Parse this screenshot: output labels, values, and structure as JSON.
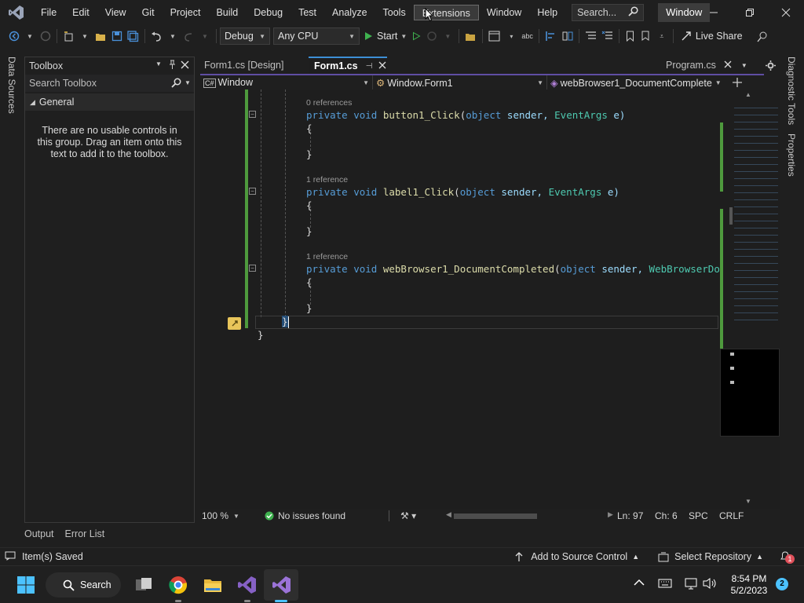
{
  "menubar": {
    "items": [
      "File",
      "Edit",
      "View",
      "Git",
      "Project",
      "Build",
      "Debug",
      "Test",
      "Analyze",
      "Tools",
      "Extensions",
      "Window",
      "Help"
    ],
    "active_index": 10,
    "search_placeholder": "Search...",
    "window_badge": "Window"
  },
  "toolbar": {
    "config": "Debug",
    "platform": "Any CPU",
    "start_label": "Start",
    "live_share": "Live Share"
  },
  "side_tabs": {
    "left": "Data Sources",
    "right_top": "Diagnostic Tools",
    "right_bottom": "Properties"
  },
  "toolbox": {
    "title": "Toolbox",
    "search_placeholder": "Search Toolbox",
    "group": "General",
    "message": "There are no usable controls in this group. Drag an item onto this text to add it to the toolbox."
  },
  "doc_tabs": [
    {
      "label": "Form1.cs [Design]",
      "active": false
    },
    {
      "label": "Form1.cs",
      "active": true
    },
    {
      "label": "Program.cs",
      "active": false
    }
  ],
  "navbar": {
    "project": "Window",
    "type": "Window.Form1",
    "member": "webBrowser1_DocumentComplete"
  },
  "code": {
    "methods": [
      {
        "refs": "0 references",
        "name": "button1_Click",
        "args": "EventArgs e)",
        "argtype": "EventArgs",
        "argname": "e)"
      },
      {
        "refs": "1 reference",
        "name": "label1_Click",
        "args": "EventArgs e)",
        "argtype": "EventArgs",
        "argname": "e)"
      },
      {
        "refs": "1 reference",
        "name": "webBrowser1_DocumentCompleted",
        "argtype": "WebBrowserDo",
        "argname": ""
      }
    ],
    "keyword_private": "private",
    "keyword_void": "void",
    "keyword_object": "object",
    "param_sender": "sender,",
    "open_brace": "{",
    "close_brace": "}"
  },
  "editor_status": {
    "zoom": "100 %",
    "issues": "No issues found",
    "line": "Ln: 97",
    "col": "Ch: 6",
    "whitespace": "SPC",
    "line_ending": "CRLF"
  },
  "bottom_tabs": [
    "Output",
    "Error List"
  ],
  "statusbar": {
    "message": "Item(s) Saved",
    "source_control": "Add to Source Control",
    "repository": "Select Repository",
    "notifications": "1"
  },
  "taskbar": {
    "search": "Search",
    "time": "8:54 PM",
    "date": "5/2/2023",
    "badge": "2"
  },
  "colors": {
    "accent": "#3d8fd6",
    "vs_purple": "#5f4ea3",
    "change_bar": "#4e9a3d",
    "green_ok": "#3fb24f"
  }
}
